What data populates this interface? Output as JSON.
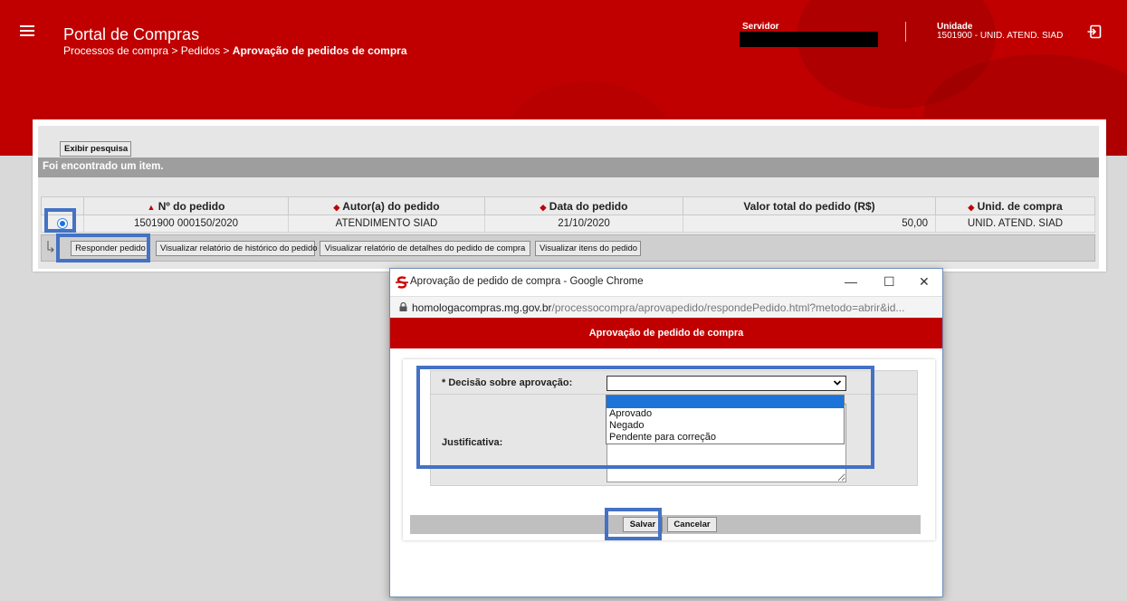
{
  "header": {
    "app_title": "Portal de Compras",
    "breadcrumb_prefix": "Processos de compra > Pedidos > ",
    "breadcrumb_current": "Aprovação de pedidos de compra",
    "server_label": "Servidor",
    "unit_label": "Unidade",
    "unit_value": "1501900 - UNID. ATEND. SIAD",
    "menu_icon": "hamburger-menu-icon",
    "logout_icon": "logout-icon"
  },
  "search": {
    "toggle_label": "Exibir pesquisa",
    "result_text": "Foi encontrado um item."
  },
  "table": {
    "columns": [
      "Nº do pedido",
      "Autor(a) do pedido",
      "Data do pedido",
      "Valor total do pedido (R$)",
      "Unid. de compra"
    ],
    "rows": [
      {
        "numero": "1501900 000150/2020",
        "autor": "ATENDIMENTO SIAD",
        "data": "21/10/2020",
        "valor": "50,00",
        "unidade": "UNID. ATEND. SIAD"
      }
    ]
  },
  "actions": {
    "responder": "Responder pedido",
    "historico": "Visualizar relatório de histórico do pedido",
    "detalhes": "Visualizar relatório de detalhes do pedido de compra",
    "itens": "Visualizar itens do pedido"
  },
  "popup": {
    "window_title": "Aprovação de pedido de compra - Google Chrome",
    "url_host": "homologacompras.mg.gov.br",
    "url_path": "/processocompra/aprovapedido/respondePedido.html?metodo=abrir&id...",
    "header": "Aprovação de pedido de compra",
    "decision_label": "* Decisão sobre aprovação:",
    "decision_value": "",
    "decision_options": [
      "",
      "Aprovado",
      "Negado",
      "Pendente para correção"
    ],
    "justify_label": "Justificativa:",
    "save_label": "Salvar",
    "cancel_label": "Cancelar",
    "window_controls": {
      "minimize": "—",
      "maximize": "☐",
      "close": "✕"
    }
  },
  "colors": {
    "brand_red": "#c00000",
    "highlight_blue": "#4472c4",
    "selection_blue": "#1e73d8"
  }
}
